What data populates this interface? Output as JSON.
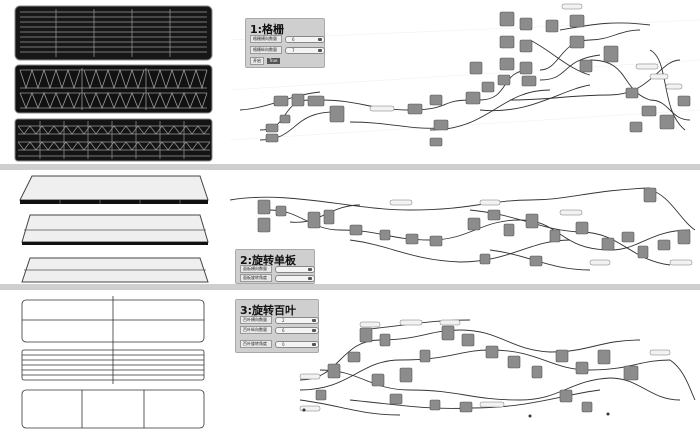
{
  "sections": [
    {
      "title": "1:格栅",
      "params": [
        {
          "label": "格栅横向数量",
          "value": "6"
        },
        {
          "label": "格栅纵向数量",
          "value": "7"
        }
      ],
      "toggle": {
        "label": "开启",
        "value": "True"
      }
    },
    {
      "title": "2:旋转单板",
      "params": [
        {
          "label": "面板横向数量",
          "value": ""
        },
        {
          "label": "面板旋转角度",
          "value": ""
        }
      ]
    },
    {
      "title": "3:旋转百叶",
      "params": [
        {
          "label": "百叶横向数量",
          "value": "2"
        },
        {
          "label": "百叶纵向数量",
          "value": "6"
        },
        {
          "label": "百叶旋转角度",
          "value": "0"
        }
      ]
    }
  ]
}
